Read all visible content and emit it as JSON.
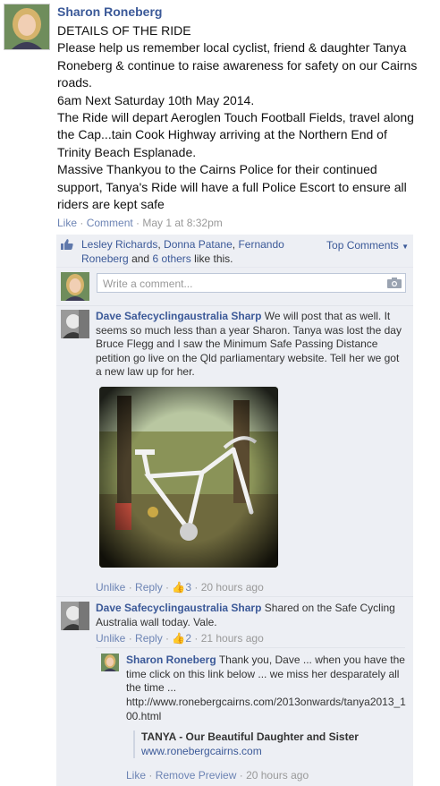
{
  "post": {
    "author": "Sharon Roneberg",
    "lines": [
      "DETAILS OF THE RIDE",
      "Please help us remember local cyclist, friend & daughter Tanya Roneberg & continue to raise awareness for safety on our Cairns roads.",
      "6am Next Saturday 10th May 2014.",
      "The Ride will depart Aeroglen Touch Football Fields, travel along the Cap...tain Cook Highway arriving at the Northern End of Trinity Beach Esplanade.",
      "Massive Thankyou to the Cairns Police for their continued support, Tanya's Ride will have a full Police Escort to ensure all riders are kept safe"
    ],
    "like_label": "Like",
    "comment_label": "Comment",
    "timestamp": "May 1 at 8:32pm"
  },
  "likes": {
    "name1": "Lesley Richards",
    "name2": "Donna Patane",
    "name3": "Fernando Roneberg",
    "and_text": "and",
    "others": "6 others",
    "suffix": "like this.",
    "top_comments": "Top Comments"
  },
  "write": {
    "placeholder": "Write a comment..."
  },
  "comments": [
    {
      "author": "Dave Safecyclingaustralia Sharp",
      "text": "We will post that as well. It seems so much less than a year Sharon. Tanya was lost the day Bruce Flegg and I saw the Minimum Safe Passing Distance petition go live on the Qld parliamentary website. Tell her we got a new law up for her.",
      "unlike": "Unlike",
      "reply": "Reply",
      "likes": "3",
      "time": "20 hours ago"
    },
    {
      "author": "Dave Safecyclingaustralia Sharp",
      "text": "Shared on the Safe Cycling Australia wall today. Vale.",
      "unlike": "Unlike",
      "reply": "Reply",
      "likes": "2",
      "time": "21 hours ago"
    }
  ],
  "reply": {
    "author": "Sharon Roneberg",
    "text": "Thank you, Dave ... when you have the time click on this link below ... we miss her desparately all the time ...",
    "url": "http://www.ronebergcairns.com/2013onwards/tanya2013_100.html",
    "preview_title": "TANYA - Our Beautiful Daughter and Sister",
    "preview_domain": "www.ronebergcairns.com",
    "like": "Like",
    "remove_preview": "Remove Preview",
    "time": "20 hours ago"
  },
  "colors": {
    "link": "#3b5998",
    "ufi_bg": "#edeff4",
    "muted_link": "#6d84b4"
  }
}
